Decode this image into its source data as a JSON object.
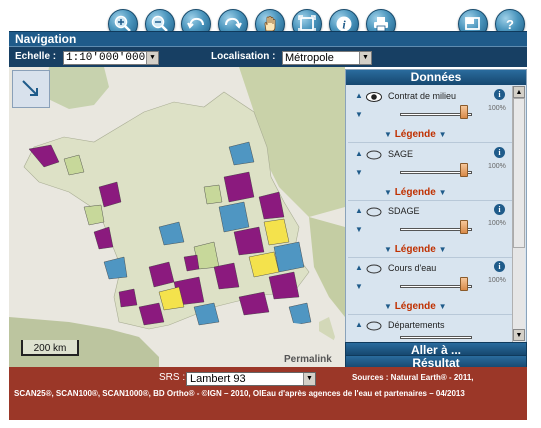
{
  "toolbar": {
    "buttons": [
      "zoom-in-icon",
      "zoom-out-icon",
      "undo-icon",
      "redo-icon",
      "pan-hand-icon",
      "full-extent-icon",
      "info-icon",
      "print-icon",
      "window-icon",
      "help-icon"
    ],
    "help_label": "?",
    "info_label": "i"
  },
  "nav": {
    "title": "Navigation"
  },
  "scale": {
    "echelle_label": "Echelle :",
    "echelle_value": "1:10'000'000",
    "localisation_label": "Localisation :",
    "localisation_value": "Métropole"
  },
  "map": {
    "scale_bar_label": "200 km",
    "permalink_label": "Permalink"
  },
  "data_panel": {
    "title": "Données",
    "layers": [
      {
        "name": "Contrat de milieu",
        "opacity": "100%",
        "visible": true,
        "legend_label": "Légende"
      },
      {
        "name": "SAGE",
        "opacity": "100%",
        "visible": false,
        "legend_label": "Légende"
      },
      {
        "name": "SDAGE",
        "opacity": "100%",
        "visible": false,
        "legend_label": "Légende"
      },
      {
        "name": "Cours d'eau",
        "opacity": "100%",
        "visible": false,
        "legend_label": "Légende"
      },
      {
        "name": "Départements",
        "opacity": "",
        "visible": false,
        "legend_label": ""
      }
    ],
    "info_label": "i"
  },
  "aller_label": "Aller à ...",
  "resultat_label": "Résultat",
  "footer": {
    "srs_label": "SRS :",
    "srs_value": "Lambert 93",
    "sources_line1": "Sources : Natural Earth® - 2011,",
    "sources_line2": "SCAN25®, SCAN100®, SCAN1000®, BD Ortho® - ©IGN – 2010, OIEau d'après agences de l'eau et partenaires – 04/2013"
  },
  "colors": {
    "accent": "#1f5b8a",
    "footer_bg": "#9b3728",
    "legend_label": "#c03000",
    "area_purple": "#8b1a7e",
    "area_blue": "#4f96c2",
    "area_yellow": "#f4e24c",
    "area_green": "#c7d89a"
  }
}
